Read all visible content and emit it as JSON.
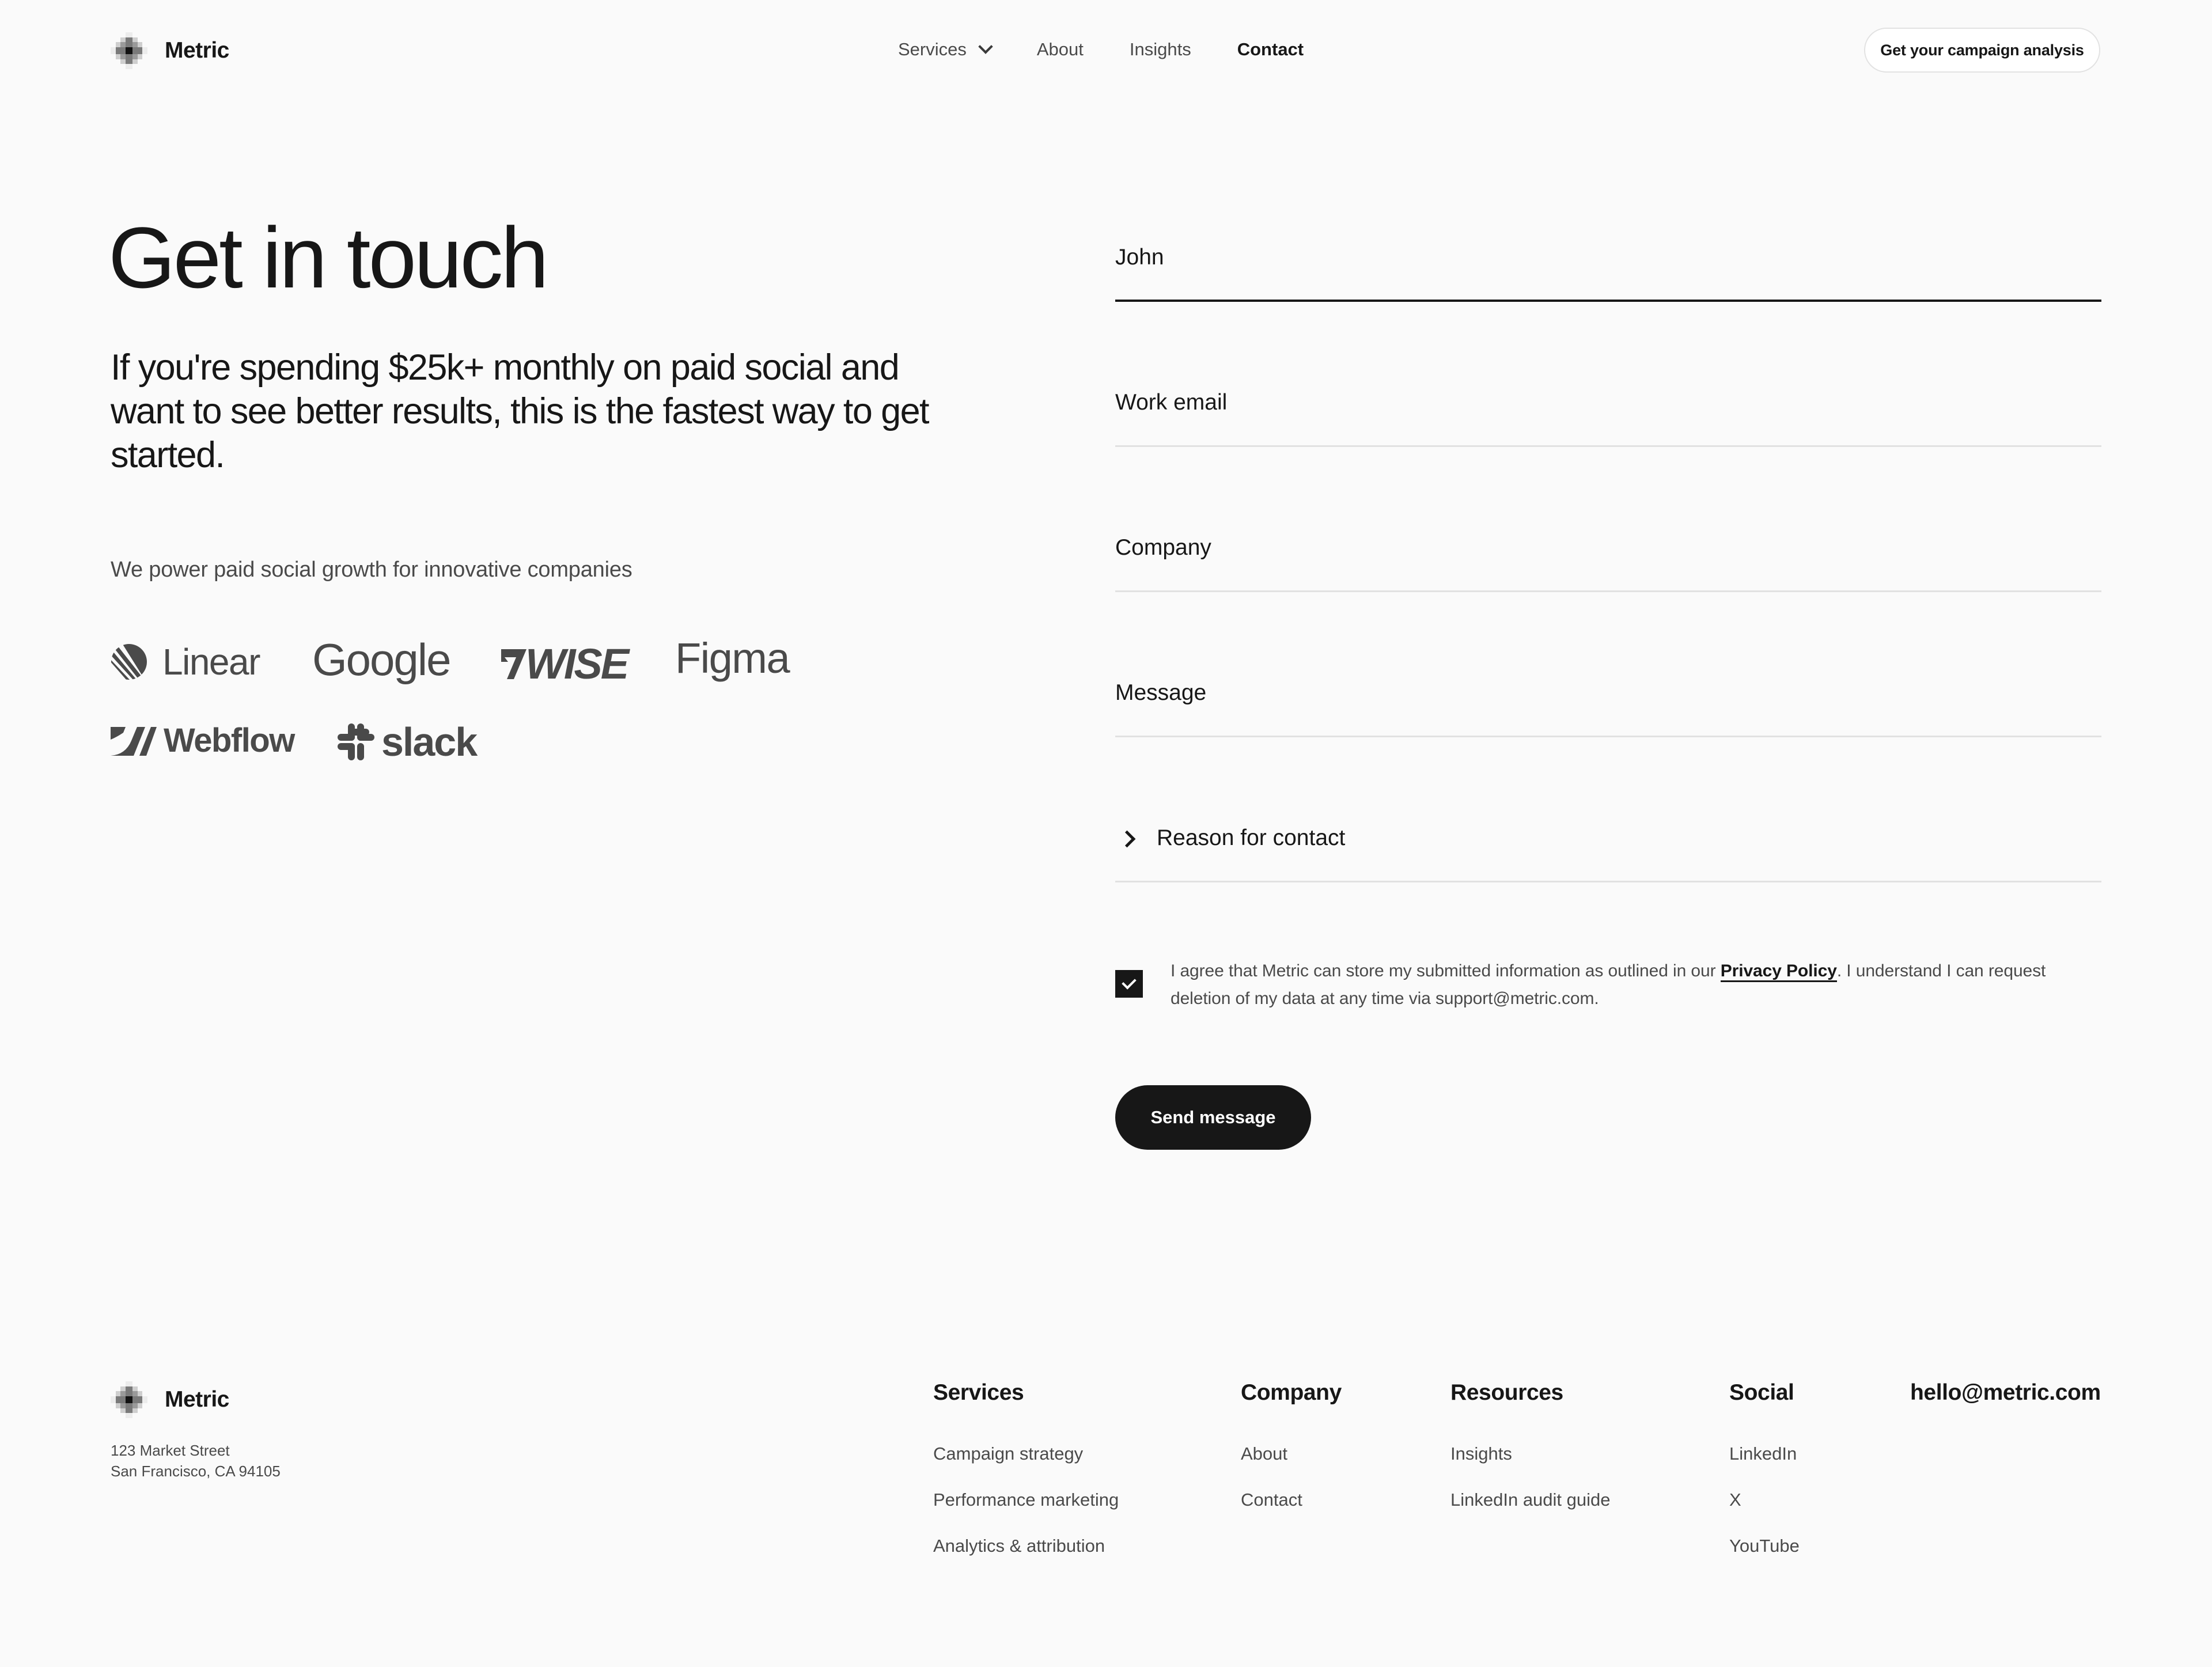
{
  "header": {
    "brand": "Metric",
    "nav": [
      {
        "label": "Services",
        "has_dropdown": true,
        "active": false
      },
      {
        "label": "About",
        "has_dropdown": false,
        "active": false
      },
      {
        "label": "Insights",
        "has_dropdown": false,
        "active": false
      },
      {
        "label": "Contact",
        "has_dropdown": false,
        "active": true
      }
    ],
    "cta_label": "Get your campaign analysis"
  },
  "hero": {
    "title": "Get in touch",
    "lead": "If you're spending $25k+ monthly on paid social and want to  see better results, this is the fastest way to get started.",
    "power_text": "We power paid social growth for innovative companies",
    "client_logos": [
      "Linear",
      "Google",
      "wise",
      "Figma",
      "Webflow",
      "slack"
    ]
  },
  "form": {
    "fields": [
      {
        "name": "first-name",
        "value": "John",
        "placeholder": "",
        "focused": true
      },
      {
        "name": "work-email",
        "value": "",
        "placeholder": "Work email",
        "focused": false
      },
      {
        "name": "company",
        "value": "",
        "placeholder": "Company",
        "focused": false
      },
      {
        "name": "message",
        "value": "",
        "placeholder": "Message",
        "focused": false
      }
    ],
    "reason_label": "Reason for contact",
    "consent": {
      "checked": true,
      "text_before": "I agree that Metric can store my submitted information as outlined in our ",
      "link_label": "Privacy Policy",
      "text_after": ". I understand I can request deletion of my data at any time via support@metric.com."
    },
    "submit_label": "Send message"
  },
  "footer": {
    "brand": "Metric",
    "address_line1": "123 Market Street",
    "address_line2": "San Francisco, CA 94105",
    "columns": [
      {
        "heading": "Services",
        "links": [
          "Campaign strategy",
          "Performance marketing",
          "Analytics & attribution"
        ]
      },
      {
        "heading": "Company",
        "links": [
          "About",
          "Contact"
        ]
      },
      {
        "heading": "Resources",
        "links": [
          "Insights",
          "LinkedIn audit guide"
        ]
      },
      {
        "heading": "Social",
        "links": [
          "LinkedIn",
          "X",
          "YouTube"
        ]
      }
    ],
    "email": "hello@metric.com"
  },
  "colors": {
    "background": "#fafafa",
    "text_primary": "#171717",
    "text_secondary": "#4a4a4a",
    "divider": "#e1e1e1",
    "button_dark": "#171717"
  }
}
